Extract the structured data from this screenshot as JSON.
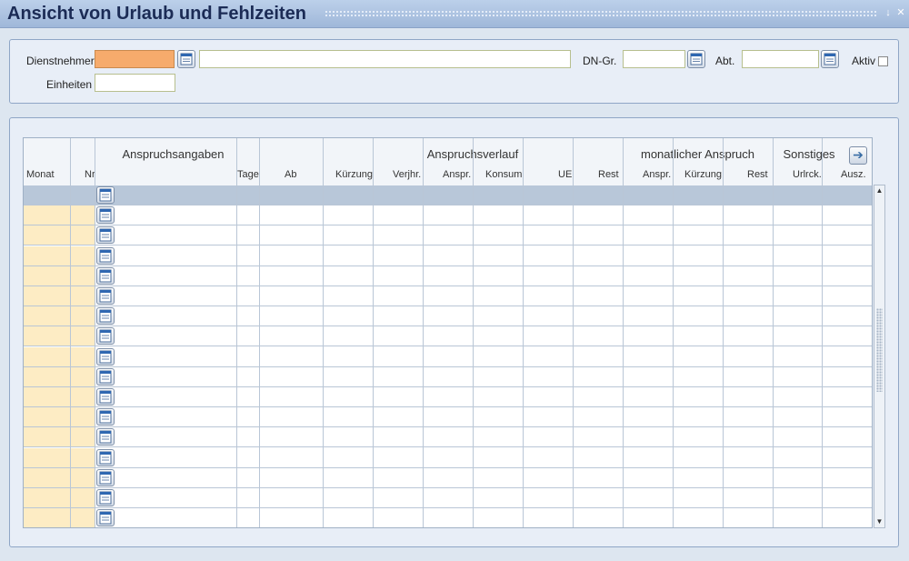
{
  "window": {
    "title": "Ansicht von Urlaub und Fehlzeiten",
    "minimize_icon": "minimize-icon",
    "close_icon": "close-icon"
  },
  "filters": {
    "dienstnehmer_label": "Dienstnehmer",
    "dienstnehmer_value": "",
    "dienstnehmer_name_value": "",
    "einheiten_label": "Einheiten",
    "einheiten_value": "",
    "dngr_label": "DN-Gr.",
    "dngr_value": "",
    "abt_label": "Abt.",
    "abt_value": "",
    "aktiv_label": "Aktiv",
    "aktiv_checked": false
  },
  "grid": {
    "groups": [
      "Anspruchsangaben",
      "Anspruchsverlauf",
      "monatlicher Anspruch",
      "Sonstiges"
    ],
    "columns": [
      "Monat",
      "Nr",
      "Tage",
      "Ab",
      "Kürzung",
      "Verjhr.",
      "Anspr.",
      "Konsum",
      "UE",
      "Rest",
      "Anspr.",
      "Kürzung",
      "Rest",
      "Urlrck.",
      "Ausz."
    ],
    "row_count": 17,
    "selected_row": 0,
    "colors": {
      "highlight": "#fdecc4",
      "selected": "#b8c7d9",
      "required": "#f6ab6c"
    }
  }
}
